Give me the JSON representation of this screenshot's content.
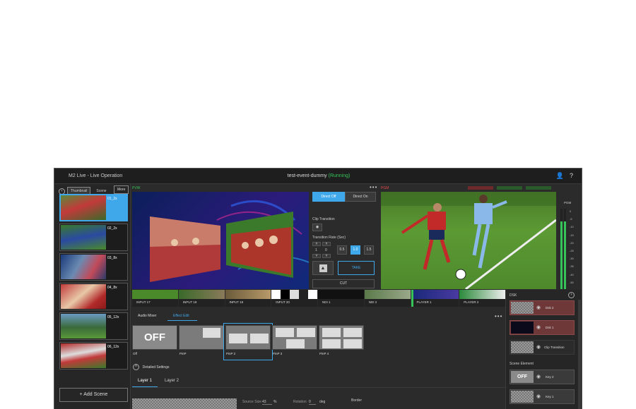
{
  "titlebar": {
    "app_title": "M2 Live - Live Operation",
    "event_name": "test-event-dummy",
    "status": "(Running)"
  },
  "left_panel": {
    "tabs": [
      "Thumbnail",
      "Scene"
    ],
    "more_label": "More",
    "scenes": [
      {
        "name": "01_2x",
        "selected": true
      },
      {
        "name": "02_2x"
      },
      {
        "name": "03_8x"
      },
      {
        "name": "04_8x"
      },
      {
        "name": "05_12x"
      },
      {
        "name": "06_12x"
      }
    ],
    "add_scene_label": "+ Add Scene"
  },
  "preview": {
    "label": "PVW"
  },
  "program": {
    "label": "PGM"
  },
  "transition": {
    "direct_off": "Direct Off",
    "direct_on": "Direct On",
    "clip_transition_label": "Clip Transition",
    "rate_label": "Transition Rate (Sec)",
    "rate_values": [
      "1",
      "0"
    ],
    "rates": [
      "0.5",
      "1.0",
      "1.5"
    ],
    "take_label": "TAKE",
    "cut_label": "CUT"
  },
  "meter": {
    "label": "PGM",
    "scale": [
      "0",
      "-5",
      "-10",
      "-15",
      "-20",
      "-25",
      "-30",
      "-35",
      "-40",
      "-50"
    ]
  },
  "inputs": [
    "INPUT 17",
    "INPUT 18",
    "INPUT 19",
    "INPUT 20",
    "NDI 1",
    "NDI 2",
    "PLAYER 1",
    "PLAYER 2"
  ],
  "effects": {
    "tabs": [
      "Audio Mixer",
      "Effect Edit"
    ],
    "items": [
      "Off",
      "PinP",
      "PinP 2",
      "PinP 3",
      "PinP 4"
    ],
    "off_text": "OFF",
    "detailed_settings": "Detailed Settings",
    "layer_tabs": [
      "Layer 1",
      "Layer 2"
    ]
  },
  "settings": {
    "source_size_label": "Source Size",
    "source_size_value": "43",
    "source_size_unit": "%",
    "rotation_label": "Rotation",
    "rotation_value": "0",
    "rotation_unit": "deg",
    "border_label": "Border"
  },
  "dsk": {
    "title": "DSK",
    "items": [
      "Dsk 2",
      "Dsk 1",
      "Clip Transition"
    ],
    "scene_element_title": "Scene Element",
    "scene_elements": [
      "Key 2",
      "Key 1"
    ],
    "off_text": "OFF"
  },
  "colors": {
    "accent": "#3fa8ea",
    "running": "#36c45a",
    "pgm": "#e04848"
  }
}
